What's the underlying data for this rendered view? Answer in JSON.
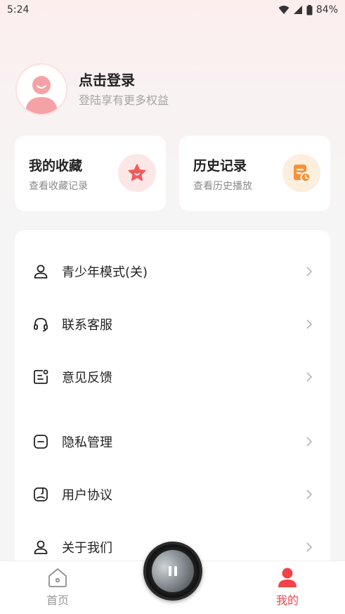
{
  "status_bar": {
    "time": "5:24",
    "battery": "84%"
  },
  "profile": {
    "title": "点击登录",
    "subtitle": "登陆享有更多权益"
  },
  "cards": [
    {
      "title": "我的收藏",
      "subtitle": "查看收藏记录",
      "icon": "star-icon",
      "color": "#f25a5e"
    },
    {
      "title": "历史记录",
      "subtitle": "查看历史播放",
      "icon": "history-doc-icon",
      "color": "#f7923a"
    }
  ],
  "menu": {
    "items": [
      {
        "label": "青少年模式(关)",
        "icon": "teen-user-icon"
      },
      {
        "label": "联系客服",
        "icon": "headset-icon"
      },
      {
        "label": "意见反馈",
        "icon": "feedback-icon"
      },
      {
        "label": "隐私管理",
        "icon": "privacy-icon"
      },
      {
        "label": "用户协议",
        "icon": "agreement-icon"
      },
      {
        "label": "关于我们",
        "icon": "about-user-icon"
      }
    ]
  },
  "tabbar": {
    "home_label": "首页",
    "mine_label": "我的",
    "accent": "#f0444b"
  }
}
